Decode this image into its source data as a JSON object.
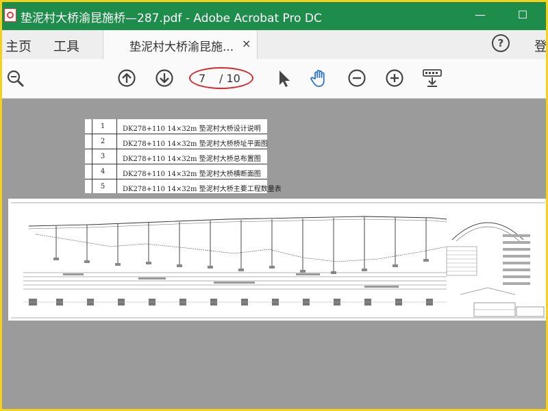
{
  "titlebar": {
    "title": "垫泥村大桥渝昆施桥—287.pdf - Adobe Acrobat Pro DC",
    "minimize": "—",
    "maximize": "☐"
  },
  "tabs": {
    "home": "主页",
    "tools": "工具",
    "document": "垫泥村大桥渝昆施...",
    "close": "×",
    "help": "?",
    "login": "登"
  },
  "toolbar": {
    "page_current": "7",
    "page_total": "/ 10",
    "icons": [
      "zoom-out-icon",
      "page-up-icon",
      "page-down-icon",
      "select-pointer-icon",
      "hand-tool-icon",
      "zoom-minus-icon",
      "zoom-plus-icon",
      "keyboard-download-icon"
    ]
  },
  "toc": [
    {
      "num": "1",
      "text": "DK278+110 14×32m  垫泥村大桥设计说明"
    },
    {
      "num": "2",
      "text": "DK278+110 14×32m  垫泥村大桥桥址平面图"
    },
    {
      "num": "3",
      "text": "DK278+110 14×32m  垫泥村大桥总布置图"
    },
    {
      "num": "4",
      "text": "DK278+110 14×32m  垫泥村大桥横断面图"
    },
    {
      "num": "5",
      "text": "DK278+110 14×32m  垫泥村大桥主要工程数量表"
    }
  ]
}
